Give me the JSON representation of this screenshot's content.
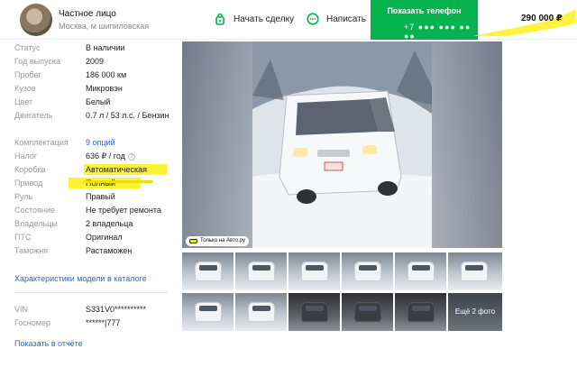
{
  "header": {
    "seller_name": "Частное лицо",
    "seller_location": "Москва, м шипиловская",
    "deal_label": "Начать сделку",
    "chat_label": "Написать",
    "phone_label": "Показать телефон",
    "phone_masked": "+7 ●●● ●●● ●● ●●",
    "price": "290 000 ₽"
  },
  "specs": [
    {
      "key": "Статус",
      "value": "В наличии"
    },
    {
      "key": "Год выпуска",
      "value": "2009"
    },
    {
      "key": "Пробег",
      "value": "186 000 км"
    },
    {
      "key": "Кузов",
      "value": "Микровэн"
    },
    {
      "key": "Цвет",
      "value": "Белый"
    },
    {
      "key": "Двигатель",
      "value": "0.7 л / 53 л.с. / Бензин"
    },
    {
      "key": "Комплектация",
      "value": "9 опций"
    },
    {
      "key": "Налог",
      "value": "636 ₽ / год"
    },
    {
      "key": "Коробка",
      "value": "Автоматическая"
    },
    {
      "key": "Привод",
      "value": "Полный"
    },
    {
      "key": "Руль",
      "value": "Правый"
    },
    {
      "key": "Состояние",
      "value": "Не требует ремонта"
    },
    {
      "key": "Владельцы",
      "value": "2 владельца"
    },
    {
      "key": "ПТС",
      "value": "Оригинал"
    },
    {
      "key": "Таможня",
      "value": "Растаможен"
    }
  ],
  "catalog_link": "Характеристики модели в каталоге",
  "vin": {
    "key": "VIN",
    "value": "S331V0**********"
  },
  "plate": {
    "key": "Госномер",
    "value": "******|777"
  },
  "history_link": "Показать в отчёте",
  "gallery": {
    "badge": "Только на Авто.ру",
    "more_label": "Ещё 2 фото"
  },
  "colors": {
    "accent_green": "#04b34b",
    "link_blue": "#3066c8",
    "highlight_yellow": "#fff233"
  }
}
